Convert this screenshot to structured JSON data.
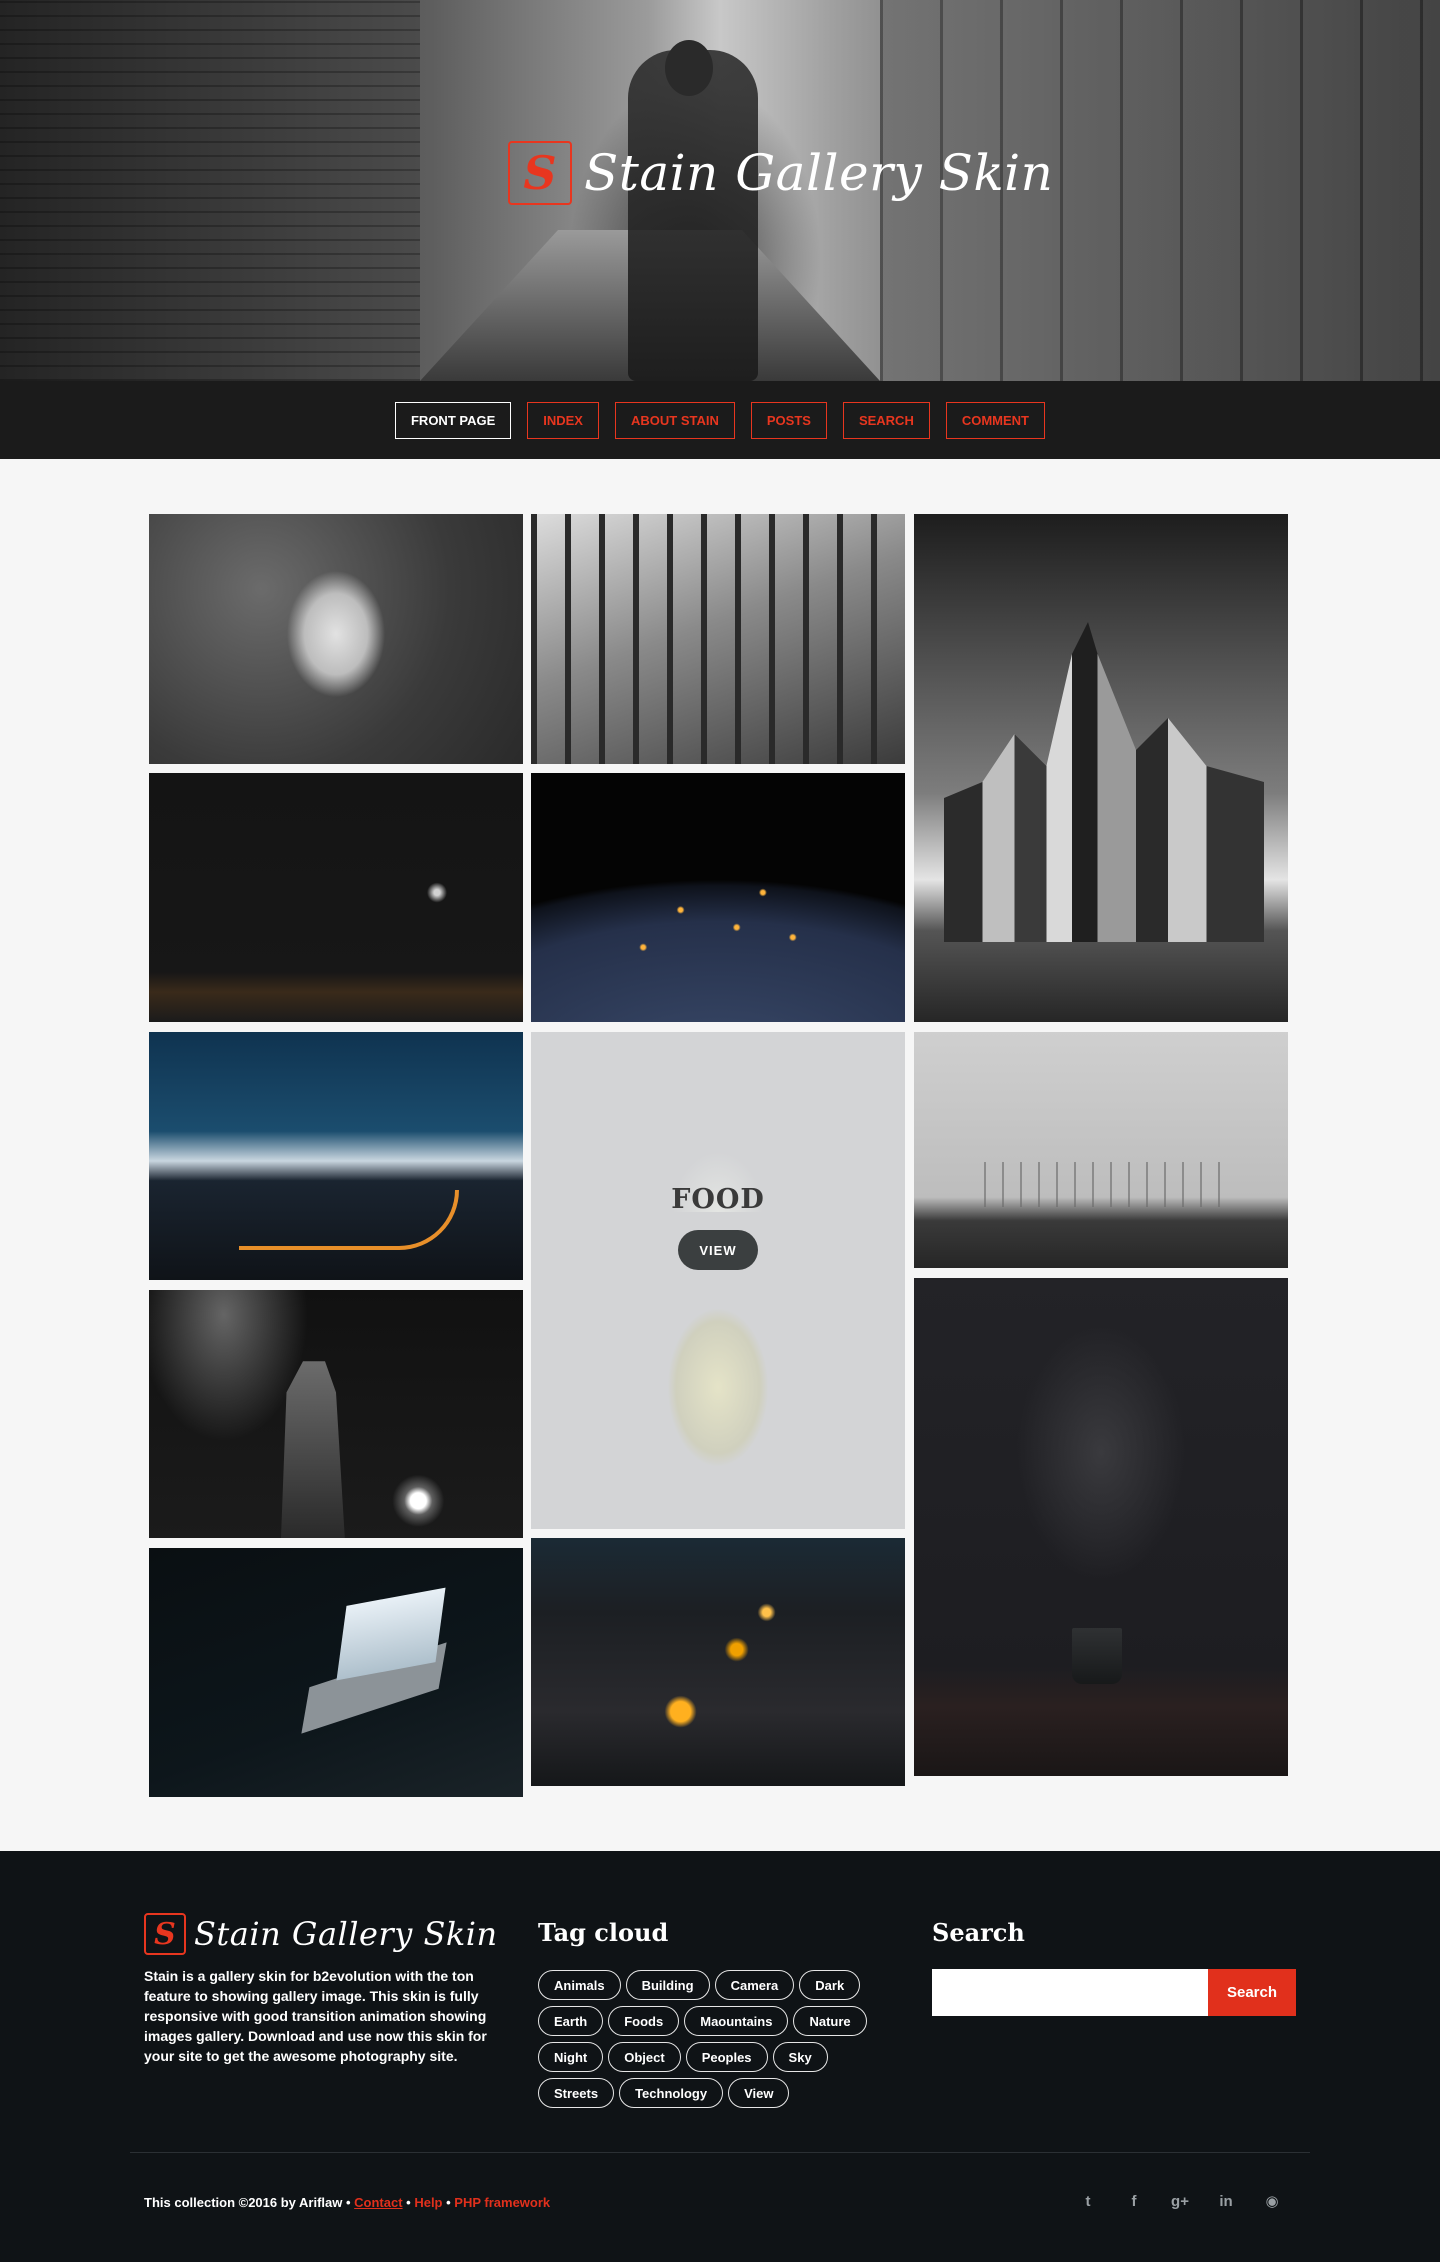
{
  "site": {
    "title": "Stain Gallery Skin",
    "logo_letter": "S",
    "accent_color": "#e8361f"
  },
  "nav": {
    "items": [
      {
        "label": "FRONT PAGE",
        "active": true
      },
      {
        "label": "INDEX",
        "active": false
      },
      {
        "label": "ABOUT STAIN",
        "active": false
      },
      {
        "label": "POSTS",
        "active": false
      },
      {
        "label": "SEARCH",
        "active": false
      },
      {
        "label": "COMMENT",
        "active": false
      }
    ]
  },
  "gallery": {
    "hover_tile": {
      "title": "FOOD",
      "button_label": "VIEW"
    }
  },
  "footer": {
    "about": "Stain is a gallery skin for b2evolution with the ton feature to showing gallery image. This skin is fully responsive with good transition animation showing images gallery. Download and use now this skin for your site to get the awesome photography site.",
    "tag_cloud_heading": "Tag cloud",
    "tags": [
      "Animals",
      "Building",
      "Camera",
      "Dark",
      "Earth",
      "Foods",
      "Maountains",
      "Nature",
      "Night",
      "Object",
      "Peoples",
      "Sky",
      "Streets",
      "Technology",
      "View"
    ],
    "search_heading": "Search",
    "search_input_value": "",
    "search_button_label": "Search",
    "credits": {
      "prefix": "This collection ©2016 by Ariflaw • ",
      "contact": "Contact",
      "sep1": " • ",
      "help": "Help",
      "sep2": " • ",
      "framework": "PHP framework"
    },
    "social_icons": [
      {
        "name": "twitter-icon",
        "glyph": "t"
      },
      {
        "name": "facebook-icon",
        "glyph": "f"
      },
      {
        "name": "google-plus-icon",
        "glyph": "g+"
      },
      {
        "name": "linkedin-icon",
        "glyph": "in"
      },
      {
        "name": "github-icon",
        "glyph": "◉"
      }
    ]
  }
}
